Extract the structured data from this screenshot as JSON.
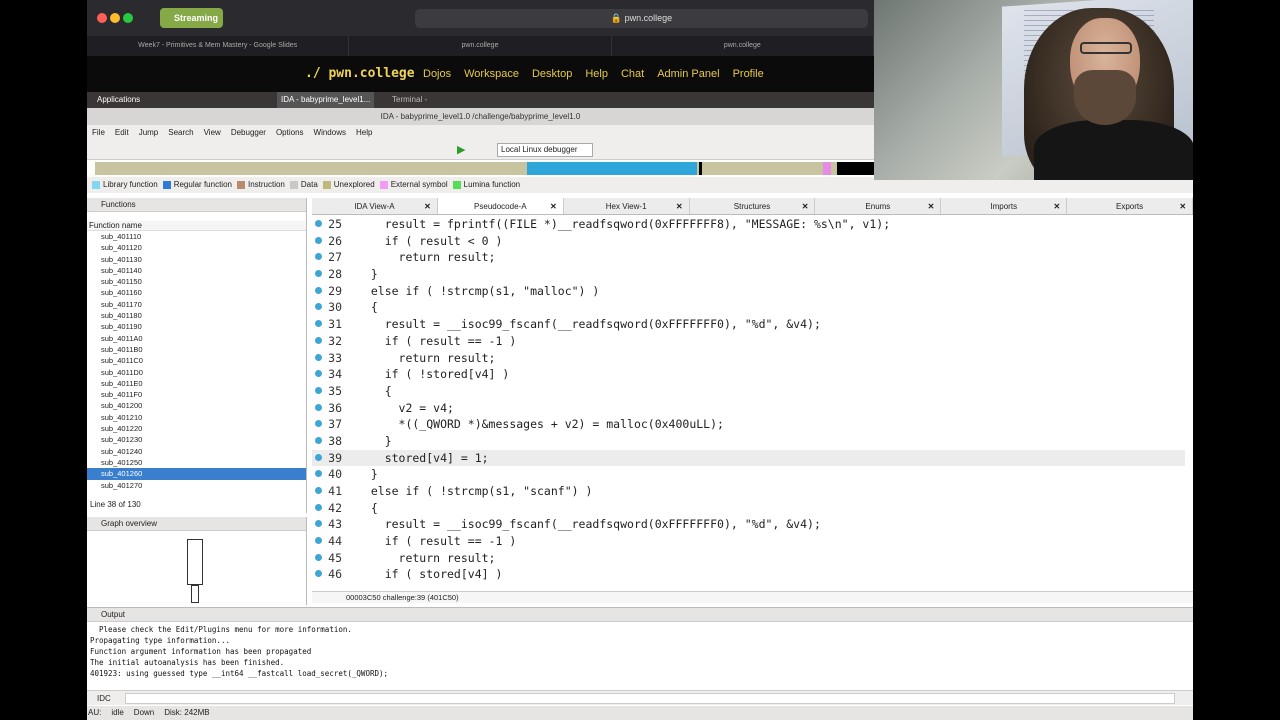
{
  "browser": {
    "streaming_label": "Streaming",
    "url": "pwn.college",
    "tabs": [
      "Week7 - Primitives & Mem Mastery - Google Slides",
      "pwn.college",
      "pwn.college"
    ]
  },
  "site_nav": {
    "logo": "./ pwn.college",
    "items": [
      "Dojos",
      "Workspace",
      "Desktop",
      "Help",
      "Chat",
      "Admin Panel",
      "Profile"
    ]
  },
  "taskbar": {
    "applications": "Applications",
    "items": [
      "IDA - babyprime_level1...",
      "Terminal -"
    ]
  },
  "ida": {
    "title": "IDA - babyprime_level1.0 /challenge/babyprime_level1.0",
    "menu": [
      "File",
      "Edit",
      "Jump",
      "Search",
      "View",
      "Debugger",
      "Options",
      "Windows",
      "Help"
    ],
    "debugger": "Local Linux debugger",
    "legend": [
      {
        "label": "Library function",
        "color": "#7fd7f0"
      },
      {
        "label": "Regular function",
        "color": "#2e7bd6"
      },
      {
        "label": "Instruction",
        "color": "#b98a6d"
      },
      {
        "label": "Data",
        "color": "#c8c8c8"
      },
      {
        "label": "Unexplored",
        "color": "#bcbc78"
      },
      {
        "label": "External symbol",
        "color": "#f29bf2"
      },
      {
        "label": "Lumina function",
        "color": "#55dd55"
      }
    ],
    "functions_title": "Functions",
    "functions_col": "Function name",
    "functions": [
      "sub_401110",
      "sub_401120",
      "sub_401130",
      "sub_401140",
      "sub_401150",
      "sub_401160",
      "sub_401170",
      "sub_401180",
      "sub_401190",
      "sub_4011A0",
      "sub_4011B0",
      "sub_4011C0",
      "sub_4011D0",
      "sub_4011E0",
      "sub_4011F0",
      "sub_401200",
      "sub_401210",
      "sub_401220",
      "sub_401230",
      "sub_401240",
      "sub_401250",
      "sub_401260",
      "sub_401270"
    ],
    "selected_function": "sub_401260",
    "line_count": "Line 38 of 130",
    "graph_title": "Graph overview",
    "code_tabs": [
      "IDA View-A",
      "Pseudocode-A",
      "Hex View-1",
      "Structures",
      "Enums",
      "Imports",
      "Exports"
    ],
    "active_tab": "Pseudocode-A",
    "code_status": "00003C50 challenge:39 (401C50)",
    "output_title": "Output",
    "output_lines": [
      "  Please check the Edit/Plugins menu for more information.",
      "Propagating type information...",
      "Function argument information has been propagated",
      "The initial autoanalysis has been finished.",
      "401923: using guessed type __int64 __fastcall load_secret(_QWORD);"
    ],
    "idc_label": "IDC",
    "status": {
      "au": "AU:",
      "state": "idle",
      "dir": "Down",
      "disk": "Disk: 242MB"
    }
  },
  "code_lines": [
    {
      "n": "25",
      "t": "    result = fprintf((FILE *)__readfsqword(0xFFFFFFF8), \"MESSAGE: %s\\n\", v1);"
    },
    {
      "n": "26",
      "t": "    if ( result < 0 )"
    },
    {
      "n": "27",
      "t": "      return result;"
    },
    {
      "n": "28",
      "t": "  }"
    },
    {
      "n": "29",
      "t": "  else if ( !strcmp(s1, \"malloc\") )"
    },
    {
      "n": "30",
      "t": "  {"
    },
    {
      "n": "31",
      "t": "    result = __isoc99_fscanf(__readfsqword(0xFFFFFFF0), \"%d\", &v4);"
    },
    {
      "n": "32",
      "t": "    if ( result == -1 )"
    },
    {
      "n": "33",
      "t": "      return result;"
    },
    {
      "n": "34",
      "t": "    if ( !stored[v4] )"
    },
    {
      "n": "35",
      "t": "    {"
    },
    {
      "n": "36",
      "t": "      v2 = v4;"
    },
    {
      "n": "37",
      "t": "      *((_QWORD *)&messages + v2) = malloc(0x400uLL);"
    },
    {
      "n": "38",
      "t": "    }"
    },
    {
      "n": "39",
      "t": "    stored[v4] = 1;"
    },
    {
      "n": "40",
      "t": "  }"
    },
    {
      "n": "41",
      "t": "  else if ( !strcmp(s1, \"scanf\") )"
    },
    {
      "n": "42",
      "t": "  {"
    },
    {
      "n": "43",
      "t": "    result = __isoc99_fscanf(__readfsqword(0xFFFFFFF0), \"%d\", &v4);"
    },
    {
      "n": "44",
      "t": "    if ( result == -1 )"
    },
    {
      "n": "45",
      "t": "      return result;"
    },
    {
      "n": "46",
      "t": "    if ( stored[v4] )"
    }
  ],
  "highlighted_line": "39"
}
